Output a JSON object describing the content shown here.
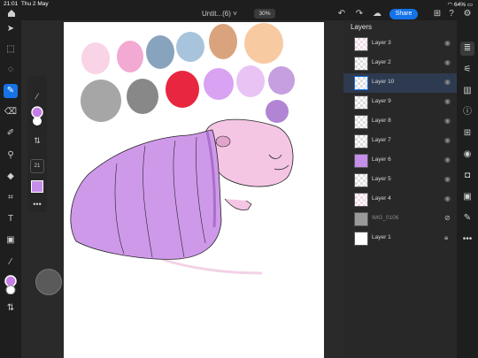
{
  "status": {
    "time": "21:01",
    "date": "Thu 2 May",
    "battery": "64%"
  },
  "document": {
    "title": "Untit...(6)",
    "title_suffix": "˅",
    "zoom": "30%"
  },
  "toolbar": {
    "share_label": "Share"
  },
  "subpanel": {
    "brush_size": "21"
  },
  "layers_panel": {
    "title": "Layers",
    "layers": [
      {
        "name": "Layer 3",
        "thumb": "pink",
        "visible": true
      },
      {
        "name": "Layer 2",
        "thumb": "chk",
        "visible": true
      },
      {
        "name": "Layer 10",
        "thumb": "chk",
        "visible": true,
        "selected": true
      },
      {
        "name": "Layer 9",
        "thumb": "chk",
        "visible": true
      },
      {
        "name": "Layer 8",
        "thumb": "chk",
        "visible": true
      },
      {
        "name": "Layer 7",
        "thumb": "chk",
        "visible": true
      },
      {
        "name": "Layer 6",
        "thumb": "purple",
        "visible": true
      },
      {
        "name": "Layer 5",
        "thumb": "chk",
        "visible": true
      },
      {
        "name": "Layer 4",
        "thumb": "pink",
        "visible": true
      },
      {
        "name": "IMG_0106",
        "thumb": "gray",
        "visible": false
      },
      {
        "name": "Layer 1",
        "thumb": "white",
        "locked": true
      }
    ]
  },
  "colors": {
    "accent": "#1473e6",
    "swatches_row1": [
      "#f9d3e6",
      "#f2a9d2",
      "#88a3bd",
      "#a8c4dc",
      "#d9a47d",
      "#f8caa2"
    ],
    "swatches_row2": [
      "#a6a6a6",
      "#888888",
      "#e8263f",
      "#d9a2f2",
      "#e9c3f4",
      "#c59fdf"
    ],
    "swatch_extra": "#b184d4",
    "foreground": "#c57ee6"
  }
}
